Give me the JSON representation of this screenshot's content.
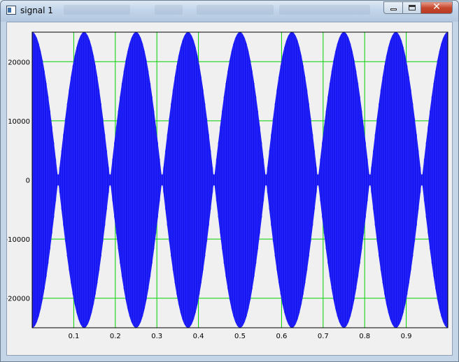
{
  "window": {
    "title": "signal 1",
    "close_glyph": "✕"
  },
  "colors": {
    "signal": "#1414f0",
    "grid": "#00d000",
    "plot_bg": "#f0f0f0",
    "frame": "#000000"
  },
  "chart_data": {
    "type": "line",
    "title": "",
    "xlabel": "",
    "ylabel": "",
    "xlim": [
      0,
      1
    ],
    "ylim": [
      -25000,
      25000
    ],
    "grid": true,
    "x_ticks": [
      0.1,
      0.2,
      0.3,
      0.4,
      0.5,
      0.6,
      0.7,
      0.8,
      0.9
    ],
    "y_ticks": [
      20000,
      10000,
      0,
      -10000,
      -20000
    ],
    "series": [
      {
        "amplitude": 25000,
        "envelope_cycles": 8,
        "carrier_cycles": 220,
        "envelope_points": [
          {
            "x": 0.0,
            "y": 25000
          },
          {
            "x": 0.025,
            "y": 22400
          },
          {
            "x": 0.05,
            "y": 15400
          },
          {
            "x": 0.0625,
            "y": 0
          },
          {
            "x": 0.075,
            "y": 15400
          },
          {
            "x": 0.1,
            "y": 22400
          },
          {
            "x": 0.125,
            "y": 25000
          },
          {
            "x": 0.15,
            "y": 22400
          },
          {
            "x": 0.175,
            "y": 15400
          },
          {
            "x": 0.1875,
            "y": 0
          },
          {
            "x": 0.2,
            "y": 15400
          },
          {
            "x": 0.225,
            "y": 22400
          },
          {
            "x": 0.25,
            "y": 25000
          }
        ]
      }
    ]
  }
}
